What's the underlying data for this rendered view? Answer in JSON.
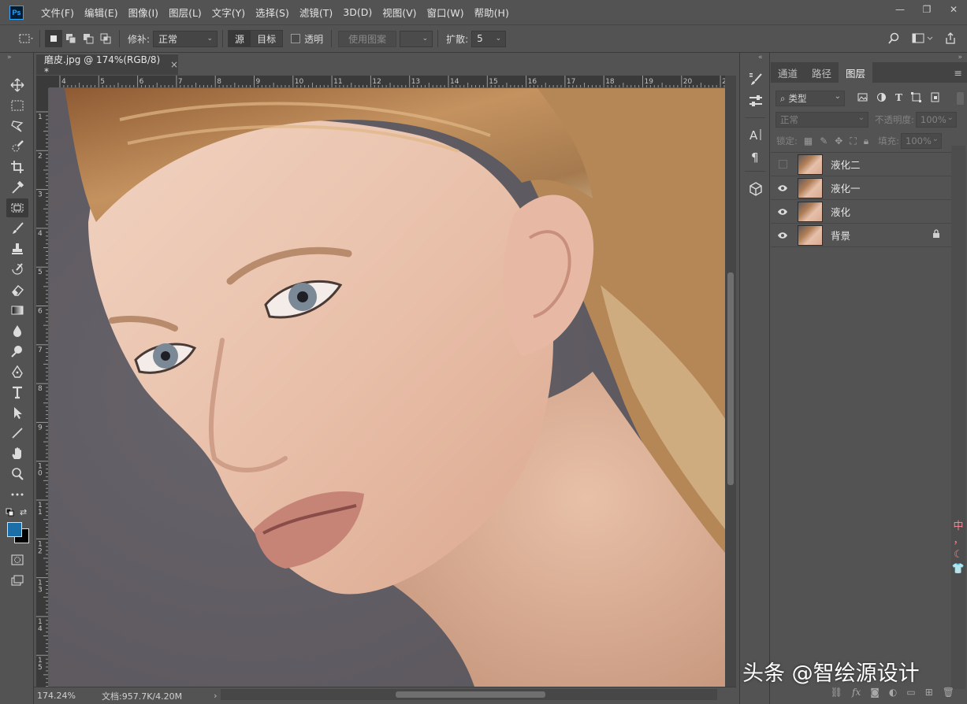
{
  "app": {
    "logo_text": "Ps"
  },
  "menu": [
    "文件(F)",
    "编辑(E)",
    "图像(I)",
    "图层(L)",
    "文字(Y)",
    "选择(S)",
    "滤镜(T)",
    "3D(D)",
    "视图(V)",
    "窗口(W)",
    "帮助(H)"
  ],
  "window_controls": {
    "minimize": "—",
    "restore": "❐",
    "close": "✕"
  },
  "options": {
    "patch_label": "修补:",
    "patch_mode": "正常",
    "source_label": "源",
    "target_label": "目标",
    "transparent_label": "透明",
    "use_pattern_label": "使用图案",
    "diffusion_label": "扩散:",
    "diffusion_value": "5"
  },
  "document": {
    "tab_title": "磨皮.jpg @ 174%(RGB/8) *",
    "close": "×",
    "zoom": "174.24%",
    "doc_info": "文档:957.7K/4.20M"
  },
  "rulers": {
    "h_labels": [
      "4",
      "5",
      "6",
      "7",
      "8",
      "9",
      "10",
      "11",
      "12",
      "13",
      "14",
      "15",
      "16",
      "17",
      "18",
      "19",
      "20",
      "2"
    ],
    "v_labels": [
      "1",
      "2",
      "3",
      "4",
      "5",
      "6",
      "7",
      "8",
      "9",
      "10",
      "11",
      "12",
      "13",
      "14",
      "15"
    ]
  },
  "panel": {
    "tabs": [
      {
        "label": "通道",
        "active": false
      },
      {
        "label": "路径",
        "active": false
      },
      {
        "label": "图层",
        "active": true
      }
    ],
    "filter_label": "类型",
    "blend_mode": "正常",
    "opacity_label": "不透明度:",
    "opacity_value": "100%",
    "lock_label": "锁定:",
    "fill_label": "填充:",
    "fill_value": "100%",
    "layers": [
      {
        "name": "液化二",
        "visible": false,
        "locked": false
      },
      {
        "name": "液化一",
        "visible": true,
        "locked": false
      },
      {
        "name": "液化",
        "visible": true,
        "locked": false
      },
      {
        "name": "背景",
        "visible": true,
        "locked": true
      }
    ],
    "footer_icons": [
      "link-icon",
      "fx-icon",
      "mask-icon",
      "adjustment-icon",
      "group-icon",
      "new-layer-icon",
      "trash-icon"
    ]
  },
  "colors": {
    "foreground": "#1b6ea8",
    "background": "#000000",
    "ui_bg": "#535353",
    "canvas_bg": "#615d62"
  },
  "watermark": "头条 @智绘源设计",
  "ime": [
    "中",
    "，",
    "☾",
    "👕"
  ]
}
